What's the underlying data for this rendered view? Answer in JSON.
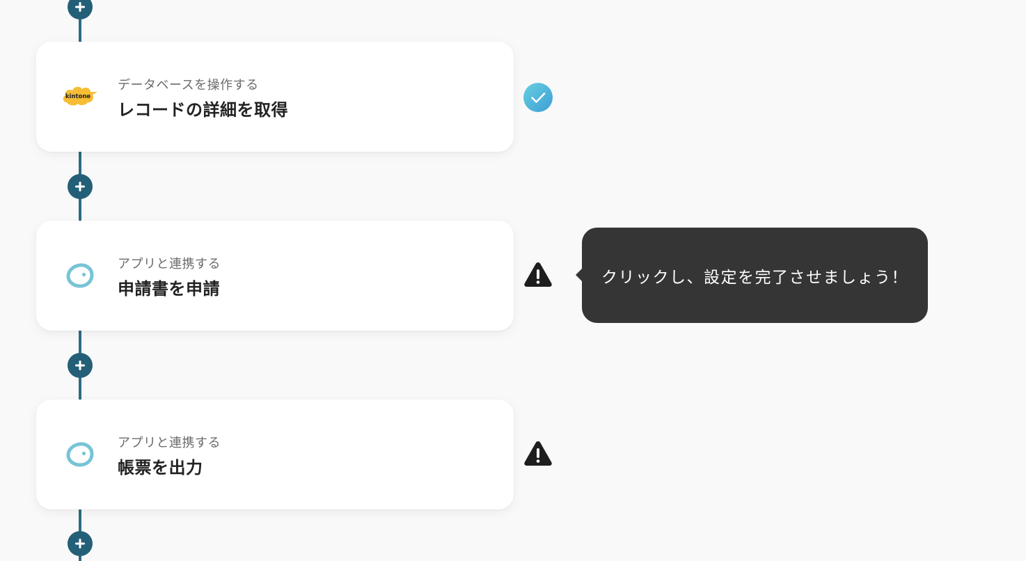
{
  "steps": [
    {
      "subtitle": "データベースを操作する",
      "title": "レコードの詳細を取得",
      "icon": "kintone-logo-icon",
      "logo_text": "kintone",
      "status": "complete"
    },
    {
      "subtitle": "アプリと連携する",
      "title": "申請書を申請",
      "icon": "yoom-app-icon",
      "status": "warning"
    },
    {
      "subtitle": "アプリと連携する",
      "title": "帳票を出力",
      "icon": "yoom-app-icon",
      "status": "warning"
    }
  ],
  "tooltip": {
    "text": "クリックし、設定を完了させましょう！"
  },
  "colors": {
    "flow_line": "#2e6b84",
    "add_button": "#245f78",
    "check_gradient_start": "#67cfe0",
    "check_gradient_end": "#3d9ed6",
    "warning": "#1e1e1e",
    "tooltip_bg": "#353535",
    "kintone_yellow": "#f6bd35",
    "app_icon_blue": "#77c4d6"
  }
}
